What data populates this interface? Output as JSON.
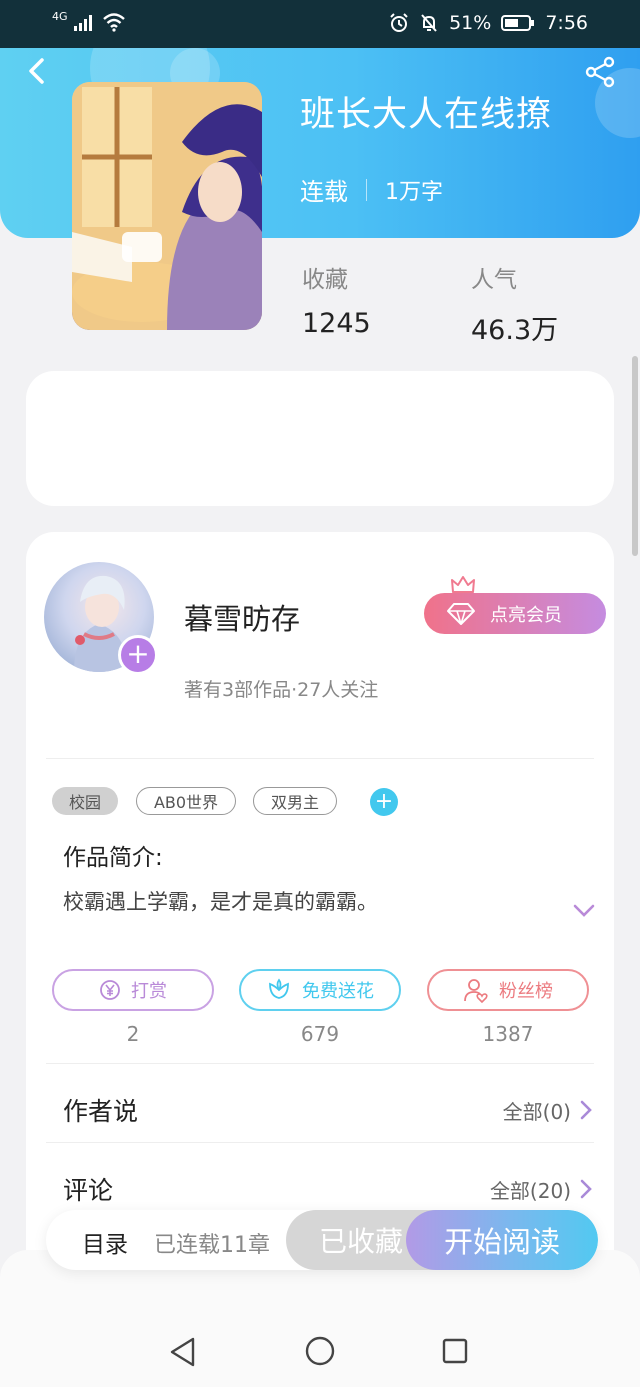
{
  "status_bar": {
    "network": "4G",
    "battery": "51%",
    "time": "7:56"
  },
  "book": {
    "title": "班长大人在线撩",
    "status": "连载",
    "word_count": "1万字",
    "stats": [
      {
        "label": "收藏",
        "value": "1245"
      },
      {
        "label": "人气",
        "value": "46.3万"
      }
    ]
  },
  "author": {
    "name": "暮雪昉存",
    "sub": "著有3部作品·27人关注",
    "vip_label": "点亮会员"
  },
  "tags": [
    "校园",
    "AB0世界",
    "双男主"
  ],
  "intro": {
    "title": "作品简介:",
    "text": "校霸遇上学霸，是才是真的霸霸。"
  },
  "actions": [
    {
      "label": "打赏",
      "count": "2",
      "color": "#b98ad8",
      "icon": "yen-icon"
    },
    {
      "label": "免费送花",
      "count": "679",
      "color": "#42c8ee",
      "icon": "flower-icon"
    },
    {
      "label": "粉丝榜",
      "count": "1387",
      "color": "#ec7b80",
      "icon": "fans-icon"
    }
  ],
  "sections": {
    "author_says": {
      "title": "作者说",
      "link": "全部(0)"
    },
    "comments": {
      "title": "评论",
      "link": "全部(20)"
    }
  },
  "bottom_bar": {
    "toc_label": "目录",
    "toc_count": "已连载11章",
    "favorite_label": "已收藏",
    "read_label": "开始阅读"
  },
  "colors": {
    "header_gradient_start": "#5fd0f2",
    "header_gradient_end": "#2f9ff0",
    "accent_purple": "#b77de6",
    "vip_pink": "#f0728a"
  }
}
